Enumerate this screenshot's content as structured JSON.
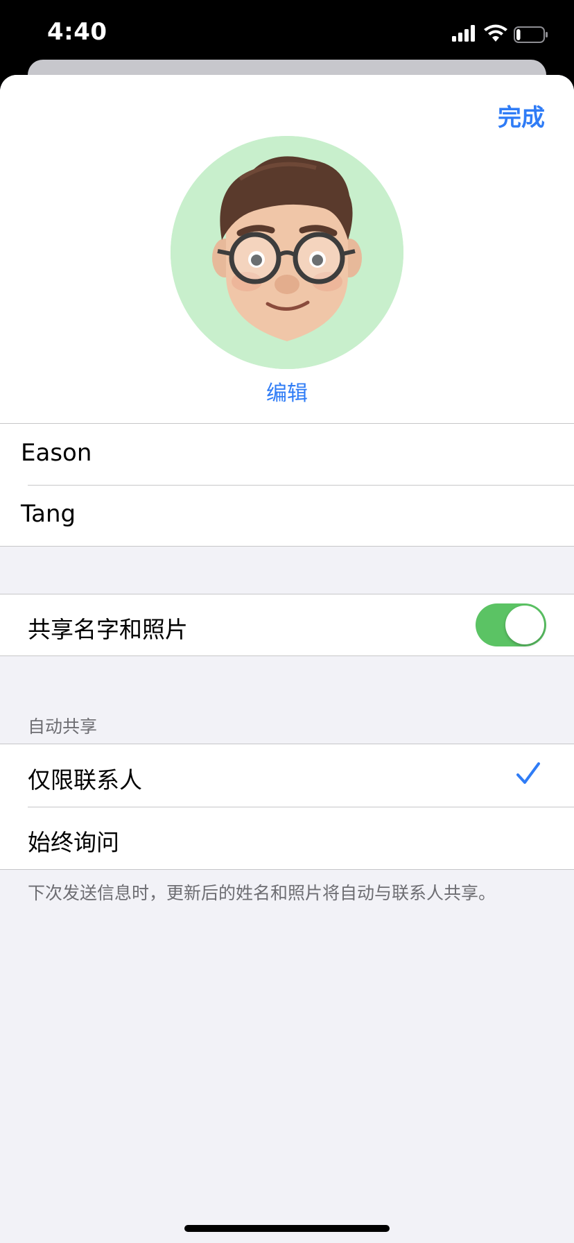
{
  "status_bar": {
    "time": "4:40",
    "battery_level": 0.15
  },
  "header": {
    "done_label": "完成"
  },
  "avatar": {
    "edit_label": "编辑",
    "background_color": "#c8efcc"
  },
  "name_fields": {
    "first_name": "Eason",
    "last_name": "Tang"
  },
  "share_setting": {
    "label": "共享名字和照片",
    "enabled": true
  },
  "auto_share": {
    "section_title": "自动共享",
    "options": [
      {
        "label": "仅限联系人",
        "selected": true
      },
      {
        "label": "始终询问",
        "selected": false
      }
    ],
    "footer": "下次发送信息时，更新后的姓名和照片将自动与联系人共享。"
  },
  "colors": {
    "accent": "#2f7cf6",
    "toggle_on": "#5bc364",
    "grouped_background": "#f2f2f7"
  }
}
